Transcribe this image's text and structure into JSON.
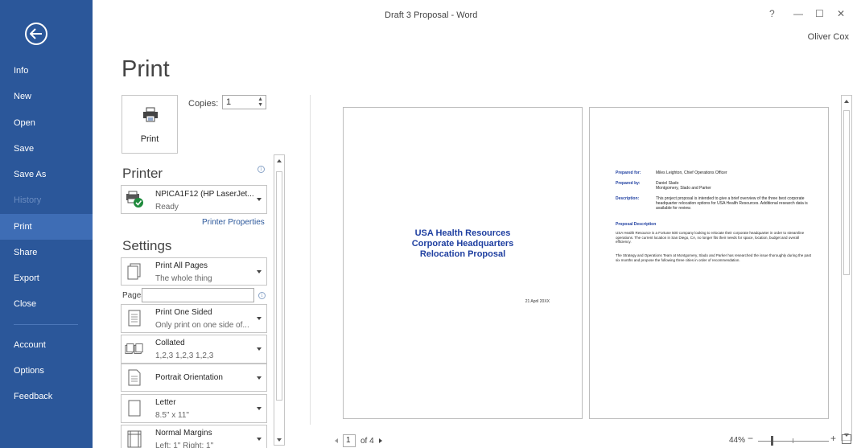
{
  "window": {
    "title": "Draft 3 Proposal - Word",
    "help": "?",
    "minimize": "—",
    "maximize": "☐",
    "close": "✕",
    "user": "Oliver Cox"
  },
  "sidebar": {
    "items": [
      {
        "label": "Info"
      },
      {
        "label": "New"
      },
      {
        "label": "Open"
      },
      {
        "label": "Save"
      },
      {
        "label": "Save As"
      },
      {
        "label": "History"
      },
      {
        "label": "Print"
      },
      {
        "label": "Share"
      },
      {
        "label": "Export"
      },
      {
        "label": "Close"
      },
      {
        "label": "Account"
      },
      {
        "label": "Options"
      },
      {
        "label": "Feedback"
      }
    ]
  },
  "print": {
    "heading": "Print",
    "button_label": "Print",
    "copies_label": "Copies:",
    "copies_value": "1"
  },
  "printer": {
    "section_title": "Printer",
    "name": "NPICA1F12 (HP LaserJet...",
    "status": "Ready",
    "properties_link": "Printer Properties"
  },
  "settings": {
    "section_title": "Settings",
    "pages_label": "Pages:",
    "pages_value": "",
    "options": [
      {
        "title": "Print All Pages",
        "subtitle": "The whole thing"
      },
      {
        "title": "Print One Sided",
        "subtitle": "Only print on one side of..."
      },
      {
        "title": "Collated",
        "subtitle": "1,2,3   1,2,3   1,2,3"
      },
      {
        "title": "Portrait Orientation",
        "subtitle": ""
      },
      {
        "title": "Letter",
        "subtitle": "8.5\" x 11\""
      },
      {
        "title": "Normal Margins",
        "subtitle": "Left: 1\"   Right: 1\""
      }
    ]
  },
  "preview": {
    "page1": {
      "title_line1": "USA Health Resources",
      "title_line2": "Corporate Headquarters",
      "title_line3": "Relocation Proposal",
      "date": "21 April 20XX"
    },
    "page2": {
      "prepared_for_label": "Prepared for:",
      "prepared_for": "Miles Leighton, Chief Operations Officer",
      "prepared_by_label": "Prepared by:",
      "prepared_by": "Daniel Slado\nMontgomery, Slado and Parker",
      "description_label": "Description:",
      "description": "This project proposal is intended to give a brief overview of the three best corporate headquarter relocation options for USA Health Resources. Additional research data is available for review.",
      "section_heading": "Proposal Description",
      "para1": "USA Health Resource is a Fortune 500 company looking to relocate their corporate headquarter in order to streamline operations. The current location in San Diego, CA, no longer fits their needs for space, location, budget and overall efficiency.",
      "para2": "The Strategy and Operations Team at Montgomery, Slado and Parker has researched the issue thoroughly during the past six months and propose the following three cities in order of recommendation."
    }
  },
  "footer": {
    "page_current": "1",
    "page_total": "of 4",
    "zoom": "44%",
    "zoom_minus": "−",
    "zoom_plus": "+"
  }
}
